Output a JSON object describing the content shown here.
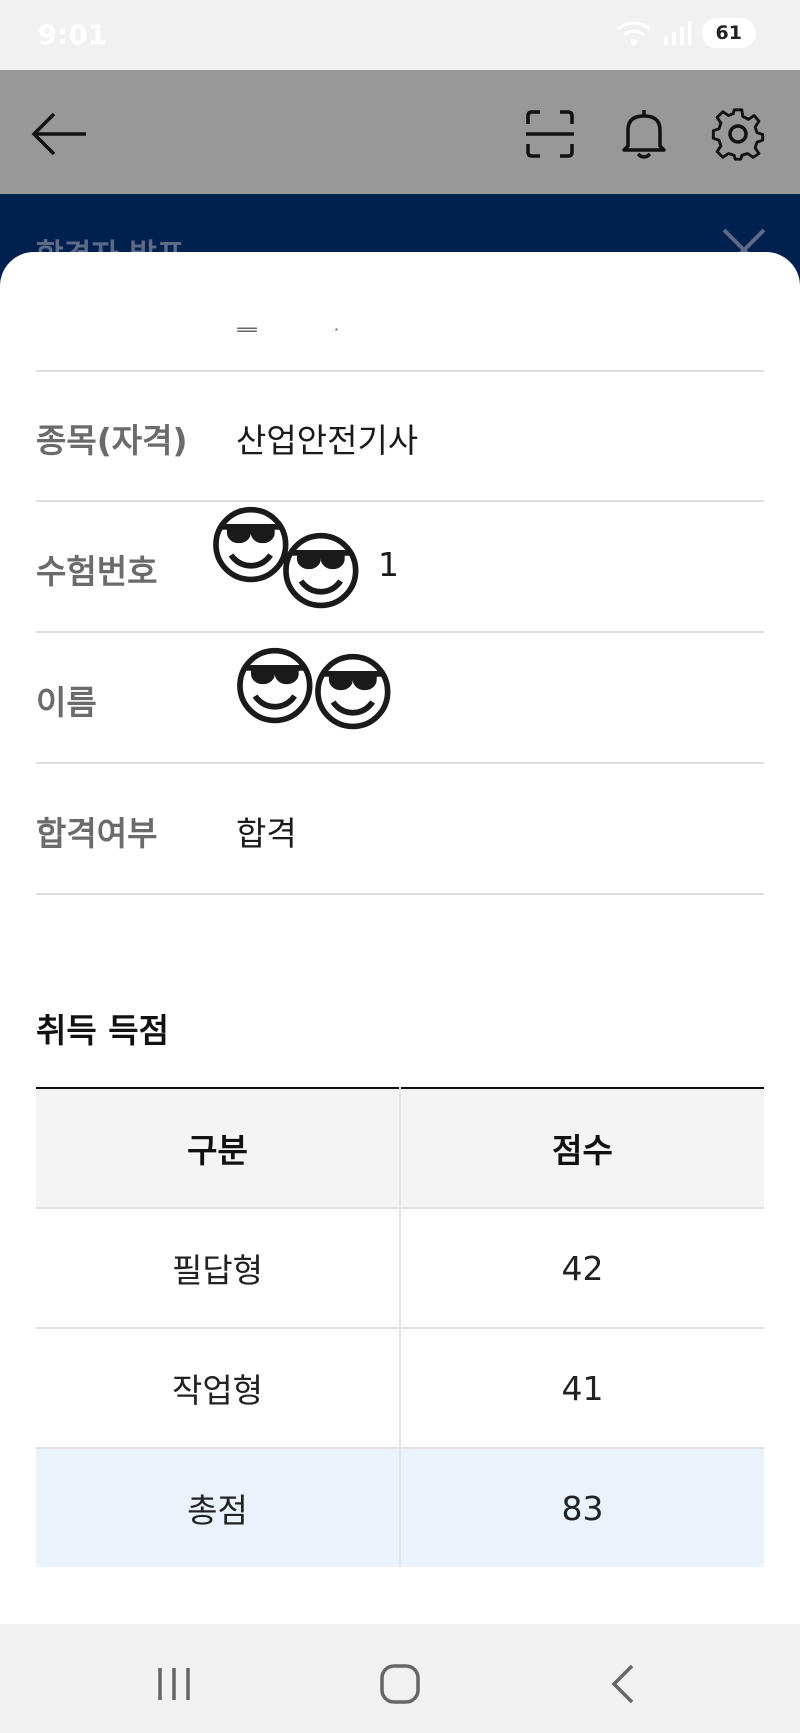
{
  "status_bar": {
    "time": "9:01",
    "battery": "61"
  },
  "app_bar": {
    "back_icon": "back-arrow-icon",
    "scan_icon": "scan-icon",
    "bell_icon": "bell-icon",
    "settings_icon": "gear-icon"
  },
  "banner": {
    "title": "합격자 발표"
  },
  "info": {
    "partial_row_fragment": "ᆖ ᅟ ᆞ",
    "rows": [
      {
        "label": "종목(자격)",
        "value": "산업안전기사"
      },
      {
        "label": "수험번호",
        "value": "1"
      },
      {
        "label": "이름",
        "value": ""
      },
      {
        "label": "합격여부",
        "value": "합격"
      }
    ]
  },
  "scores": {
    "title": "취득 득점",
    "headers": [
      "구분",
      "점수"
    ],
    "rows": [
      {
        "category": "필답형",
        "score": "42"
      },
      {
        "category": "작업형",
        "score": "41"
      },
      {
        "category": "총점",
        "score": "83"
      }
    ]
  },
  "colors": {
    "banner": "#002050",
    "app_bar": "#989898",
    "total_row": "#eaf2fc"
  }
}
